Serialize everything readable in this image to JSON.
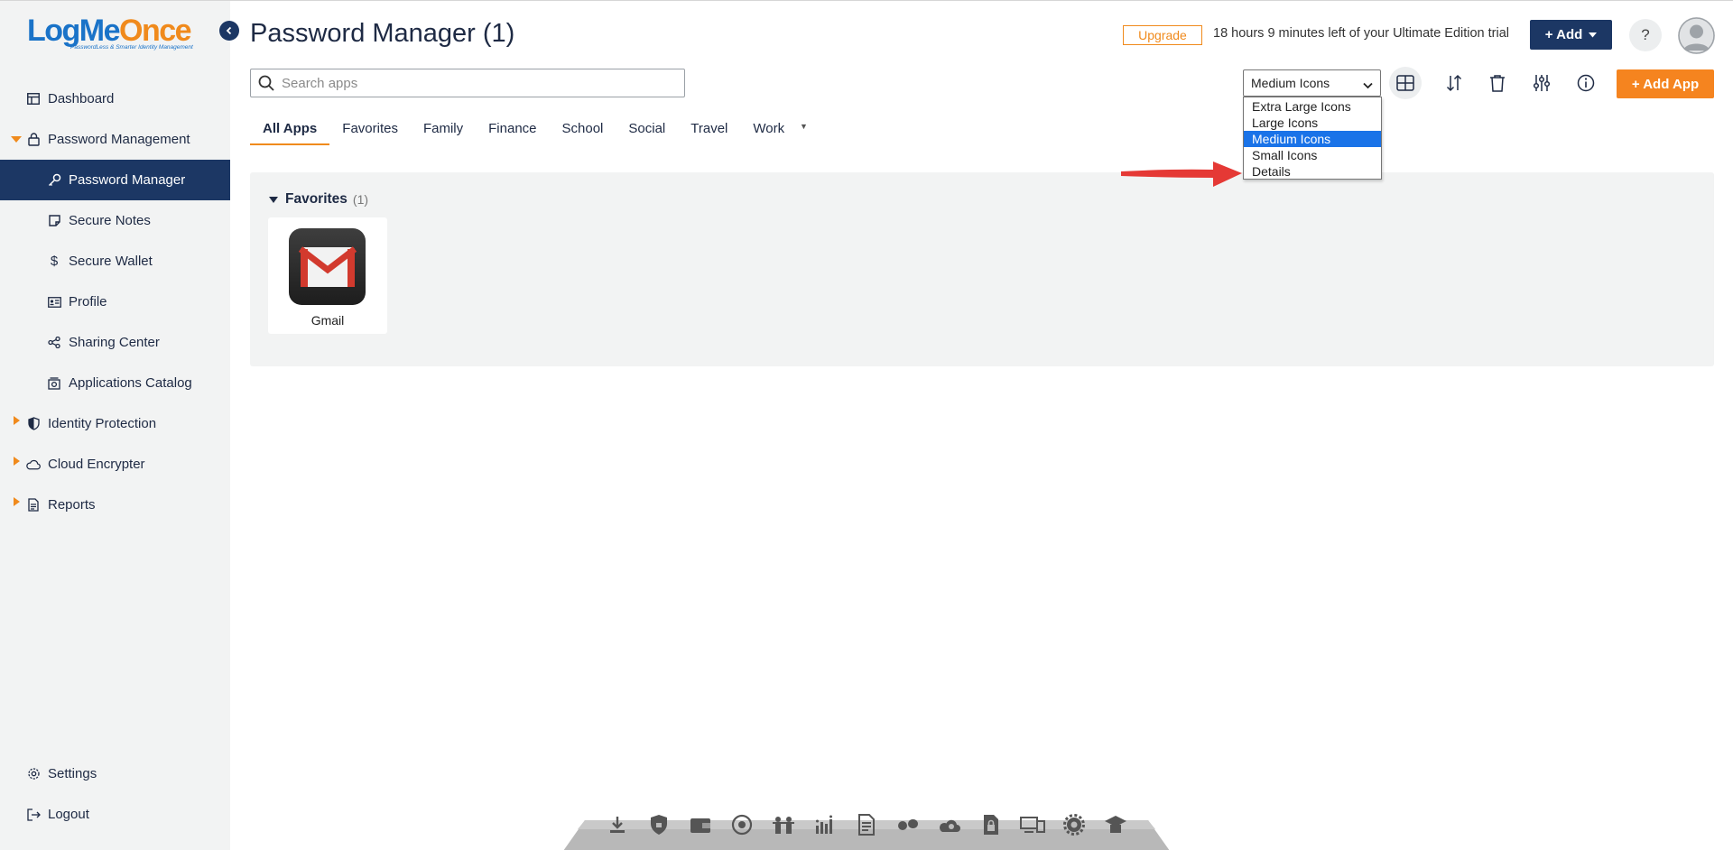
{
  "brand": {
    "name_part1": "LogMe",
    "name_part2": "Once",
    "tagline": "PasswordLess & Smarter Identity Management"
  },
  "sidebar": {
    "items": [
      {
        "label": "Dashboard",
        "icon": "dashboard-icon"
      },
      {
        "label": "Password Management",
        "icon": "lock-icon",
        "expanded": true
      },
      {
        "label": "Password Manager",
        "icon": "key-icon",
        "active": true
      },
      {
        "label": "Secure Notes",
        "icon": "note-icon"
      },
      {
        "label": "Secure Wallet",
        "icon": "dollar-icon"
      },
      {
        "label": "Profile",
        "icon": "id-card-icon"
      },
      {
        "label": "Sharing Center",
        "icon": "share-icon"
      },
      {
        "label": "Applications Catalog",
        "icon": "catalog-icon"
      },
      {
        "label": "Identity Protection",
        "icon": "shield-icon"
      },
      {
        "label": "Cloud Encrypter",
        "icon": "cloud-icon"
      },
      {
        "label": "Reports",
        "icon": "report-icon"
      }
    ],
    "bottom": [
      {
        "label": "Settings",
        "icon": "gear-icon"
      },
      {
        "label": "Logout",
        "icon": "logout-icon"
      }
    ]
  },
  "header": {
    "title": "Password Manager (1)",
    "upgrade_label": "Upgrade",
    "trial_text": "18 hours 9 minutes left of your Ultimate Edition trial",
    "add_label": "+ Add",
    "help_label": "?"
  },
  "search": {
    "placeholder": "Search apps",
    "value": ""
  },
  "toolbar": {
    "view_selected": "Medium Icons",
    "view_options": [
      "Extra Large Icons",
      "Large Icons",
      "Medium Icons",
      "Small Icons",
      "Details"
    ],
    "add_app_label": "+ Add App"
  },
  "tabs": [
    "All Apps",
    "Favorites",
    "Family",
    "Finance",
    "School",
    "Social",
    "Travel",
    "Work"
  ],
  "tab_more_glyph": "▼",
  "favorites": {
    "title": "Favorites",
    "count": "(1)",
    "apps": [
      {
        "label": "Gmail",
        "icon": "gmail-icon"
      }
    ]
  },
  "colors": {
    "navy": "#1c3764",
    "orange": "#f5841f",
    "select_blue": "#1a73e8",
    "arrow_red": "#e53935"
  }
}
